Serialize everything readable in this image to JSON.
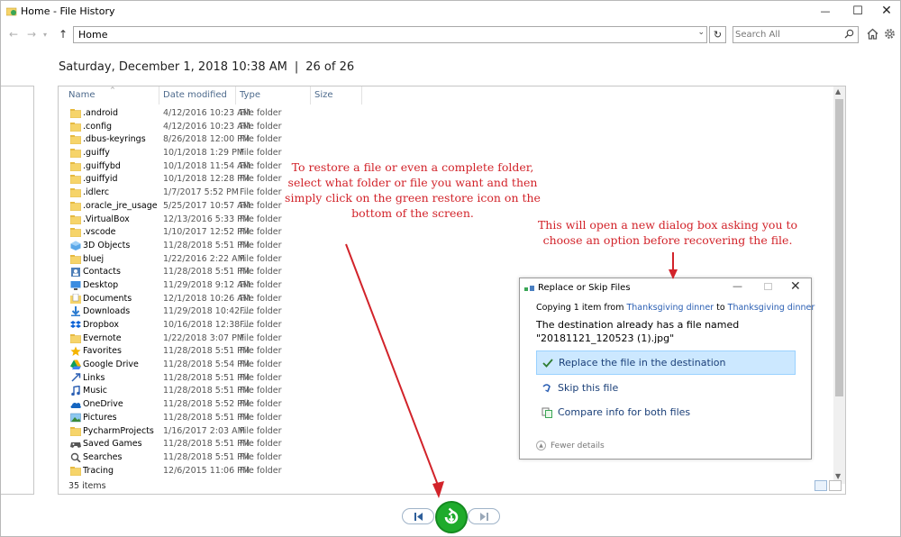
{
  "window": {
    "title": "Home - File History",
    "minimize": "—",
    "maximize": "☐",
    "close": "✕"
  },
  "nav": {
    "address": "Home",
    "search_placeholder": "Search All"
  },
  "snapshot": {
    "date": "Saturday, December 1, 2018 10:38 AM",
    "separator": "|",
    "position": "26 of 26"
  },
  "columns": {
    "name": "Name",
    "date": "Date modified",
    "type": "Type",
    "size": "Size"
  },
  "files": [
    {
      "name": ".android",
      "date": "4/12/2016 10:23 AM",
      "type": "File folder",
      "icon": "folder-icon"
    },
    {
      "name": ".config",
      "date": "4/12/2016 10:23 AM",
      "type": "File folder",
      "icon": "folder-icon"
    },
    {
      "name": ".dbus-keyrings",
      "date": "8/26/2018 12:00 PM",
      "type": "File folder",
      "icon": "folder-icon"
    },
    {
      "name": ".guiffy",
      "date": "10/1/2018 1:29 PM",
      "type": "File folder",
      "icon": "folder-icon"
    },
    {
      "name": ".guiffybd",
      "date": "10/1/2018 11:54 AM",
      "type": "File folder",
      "icon": "folder-icon"
    },
    {
      "name": ".guiffyid",
      "date": "10/1/2018 12:28 PM",
      "type": "File folder",
      "icon": "folder-icon"
    },
    {
      "name": ".idlerc",
      "date": "1/7/2017 5:52 PM",
      "type": "File folder",
      "icon": "folder-icon"
    },
    {
      "name": ".oracle_jre_usage",
      "date": "5/25/2017 10:57 AM",
      "type": "File folder",
      "icon": "folder-icon"
    },
    {
      "name": ".VirtualBox",
      "date": "12/13/2016 5:33 PM",
      "type": "File folder",
      "icon": "folder-icon"
    },
    {
      "name": ".vscode",
      "date": "1/10/2017 12:52 PM",
      "type": "File folder",
      "icon": "folder-icon"
    },
    {
      "name": "3D Objects",
      "date": "11/28/2018 5:51 PM",
      "type": "File folder",
      "icon": "3d-objects-icon"
    },
    {
      "name": "bluej",
      "date": "1/22/2016 2:22 AM",
      "type": "File folder",
      "icon": "folder-icon"
    },
    {
      "name": "Contacts",
      "date": "11/28/2018 5:51 PM",
      "type": "File folder",
      "icon": "contacts-icon"
    },
    {
      "name": "Desktop",
      "date": "11/29/2018 9:12 AM",
      "type": "File folder",
      "icon": "desktop-icon"
    },
    {
      "name": "Documents",
      "date": "12/1/2018 10:26 AM",
      "type": "File folder",
      "icon": "documents-icon"
    },
    {
      "name": "Downloads",
      "date": "11/29/2018 10:42 ...",
      "type": "File folder",
      "icon": "downloads-icon"
    },
    {
      "name": "Dropbox",
      "date": "10/16/2018 12:38 ...",
      "type": "File folder",
      "icon": "dropbox-icon"
    },
    {
      "name": "Evernote",
      "date": "1/22/2018 3:07 PM",
      "type": "File folder",
      "icon": "folder-icon"
    },
    {
      "name": "Favorites",
      "date": "11/28/2018 5:51 PM",
      "type": "File folder",
      "icon": "star-icon"
    },
    {
      "name": "Google Drive",
      "date": "11/28/2018 5:54 PM",
      "type": "File folder",
      "icon": "google-drive-icon"
    },
    {
      "name": "Links",
      "date": "11/28/2018 5:51 PM",
      "type": "File folder",
      "icon": "links-icon"
    },
    {
      "name": "Music",
      "date": "11/28/2018 5:51 PM",
      "type": "File folder",
      "icon": "music-icon"
    },
    {
      "name": "OneDrive",
      "date": "11/28/2018 5:52 PM",
      "type": "File folder",
      "icon": "onedrive-icon"
    },
    {
      "name": "Pictures",
      "date": "11/28/2018 5:51 PM",
      "type": "File folder",
      "icon": "pictures-icon"
    },
    {
      "name": "PycharmProjects",
      "date": "1/16/2017 2:03 AM",
      "type": "File folder",
      "icon": "folder-icon"
    },
    {
      "name": "Saved Games",
      "date": "11/28/2018 5:51 PM",
      "type": "File folder",
      "icon": "saved-games-icon"
    },
    {
      "name": "Searches",
      "date": "11/28/2018 5:51 PM",
      "type": "File folder",
      "icon": "search-icon"
    },
    {
      "name": "Tracing",
      "date": "12/6/2015 11:06 PM",
      "type": "File folder",
      "icon": "folder-icon"
    }
  ],
  "items_count": "35 items",
  "annotations": {
    "restore_help": "To restore a file or even a complete folder,\nselect what folder or file you want and then\nsimply click on the green restore icon on the\nbottom of the screen.",
    "dialog_help": "This will open a new dialog box asking you to\nchoose an option before recovering the file."
  },
  "dialog": {
    "title": "Replace or Skip Files",
    "copying_prefix": "Copying 1 item from ",
    "copying_from": "Thanksgiving dinner",
    "copying_to_word": " to ",
    "copying_to": "Thanksgiving dinner",
    "destination_msg": "The destination already has a file named\n\"20181121_120523 (1).jpg\"",
    "options": [
      {
        "label": "Replace the file in the destination",
        "icon": "checkmark-icon"
      },
      {
        "label": "Skip this file",
        "icon": "skip-icon"
      },
      {
        "label": "Compare info for both files",
        "icon": "compare-icon"
      }
    ],
    "fewer_details": "Fewer details"
  },
  "colors": {
    "annotation_red": "#d2232a",
    "restore_green": "#1fab2c",
    "folder_yellow": "#f6d46a",
    "link_blue": "#2b5fb3",
    "selection_blue": "#cce8ff"
  }
}
